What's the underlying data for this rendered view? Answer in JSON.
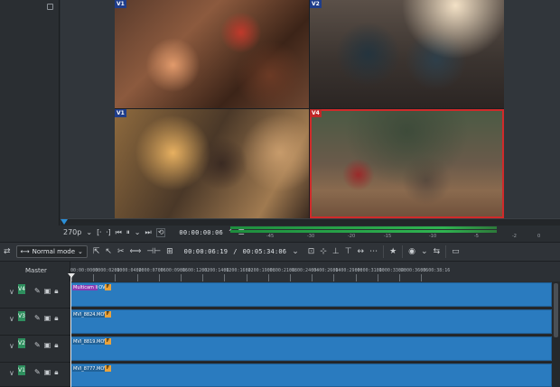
{
  "monitor": {
    "cameras": [
      {
        "tag": "V1"
      },
      {
        "tag": "V2"
      },
      {
        "tag": "V1"
      },
      {
        "tag": "V4"
      }
    ],
    "zoom": "270p",
    "position_timecode": "00:00:00:06",
    "meter_labels": [
      "-45",
      "-30",
      "-20",
      "-15",
      "-10",
      "-5",
      "-2",
      "0"
    ]
  },
  "toolbar": {
    "mode_label": "Normal mode",
    "position_timecode": "00:00:06:19",
    "duration_timecode": "00:05:34:06"
  },
  "timeline": {
    "master_label": "Master",
    "ruler_labels": [
      "00:00:00:00",
      "00:00:02:10",
      "00:00:04:20",
      "00:00:07:06",
      "00:00:09:16",
      "00:00:12:02",
      "00:00:14:12",
      "00:00:16:22",
      "00:00:19:08",
      "00:00:21:18",
      "00:00:24:04",
      "00:00:26:14",
      "00:00:29:00",
      "00:00:31:10",
      "00:00:33:20",
      "00:00:36:06",
      "00:00:38:16"
    ],
    "tracks": [
      {
        "tag": "V4",
        "clip": "Multicam li"
      },
      {
        "tag": "V3",
        "clip": "MVI_8824.MOV"
      },
      {
        "tag": "V2",
        "clip": "MVI_8819.MOV"
      },
      {
        "tag": "V1",
        "clip": "MVI_8777.MOV"
      }
    ],
    "fx_badge": "F",
    "first_clip_suffix": "OV"
  }
}
